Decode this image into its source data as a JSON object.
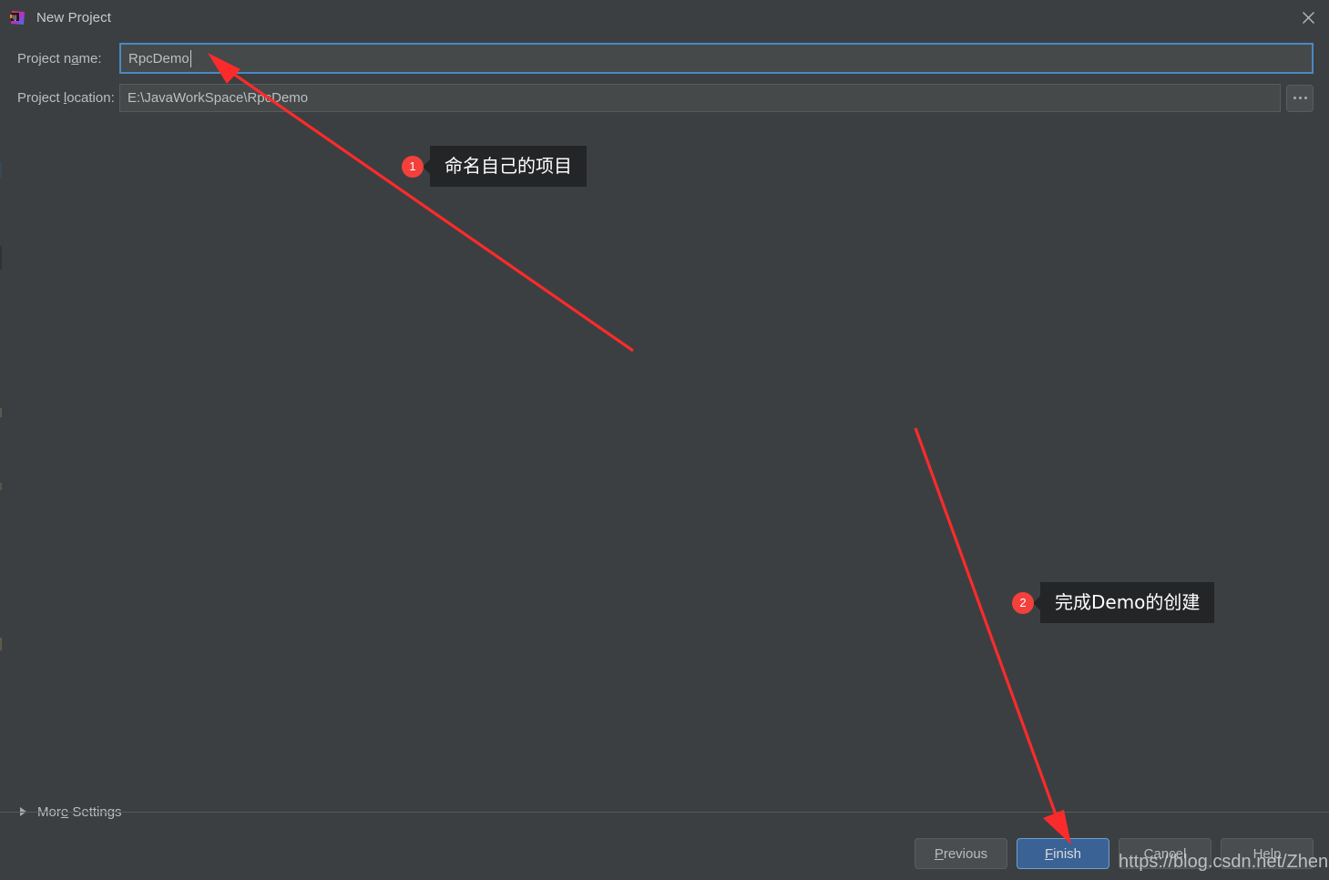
{
  "window": {
    "title": "New Project",
    "app_icon": "intellij-idea-icon",
    "close_icon": "close-icon",
    "background": "#3c3f41"
  },
  "form": {
    "name_field": {
      "label": "Project name:",
      "label_mnemonic": "n",
      "value": "RpcDemo",
      "focused": true,
      "focus_border_color": "#4a88c7"
    },
    "location_field": {
      "label": "Project location:",
      "label_mnemonic": "l",
      "value": "E:\\JavaWorkSpace\\RpcDemo",
      "browse_button_label": "...",
      "browse_icon": "ellipsis-icon"
    }
  },
  "more_settings": {
    "label": "More Settings",
    "label_mnemonic": "e",
    "expanded": false,
    "toggle_icon": "chevron-right-icon"
  },
  "buttons": [
    {
      "name": "previous",
      "label": "Previous",
      "mnemonic": "P",
      "primary": false
    },
    {
      "name": "finish",
      "label": "Finish",
      "mnemonic": "F",
      "primary": true
    },
    {
      "name": "cancel",
      "label": "Cancel",
      "mnemonic": "",
      "primary": false
    },
    {
      "name": "help",
      "label": "Help",
      "mnemonic": "",
      "primary": false
    }
  ],
  "annotations": {
    "badge_color": "#f4403c",
    "bubble_color": "#232527",
    "arrow_color": "#fb2b2b",
    "callouts": [
      {
        "number": "1",
        "text": "命名自己的项目"
      },
      {
        "number": "2",
        "text": "完成Demo的创建"
      }
    ]
  },
  "watermark": {
    "text": "https://blog.csdn.net/Zheng_lan"
  }
}
